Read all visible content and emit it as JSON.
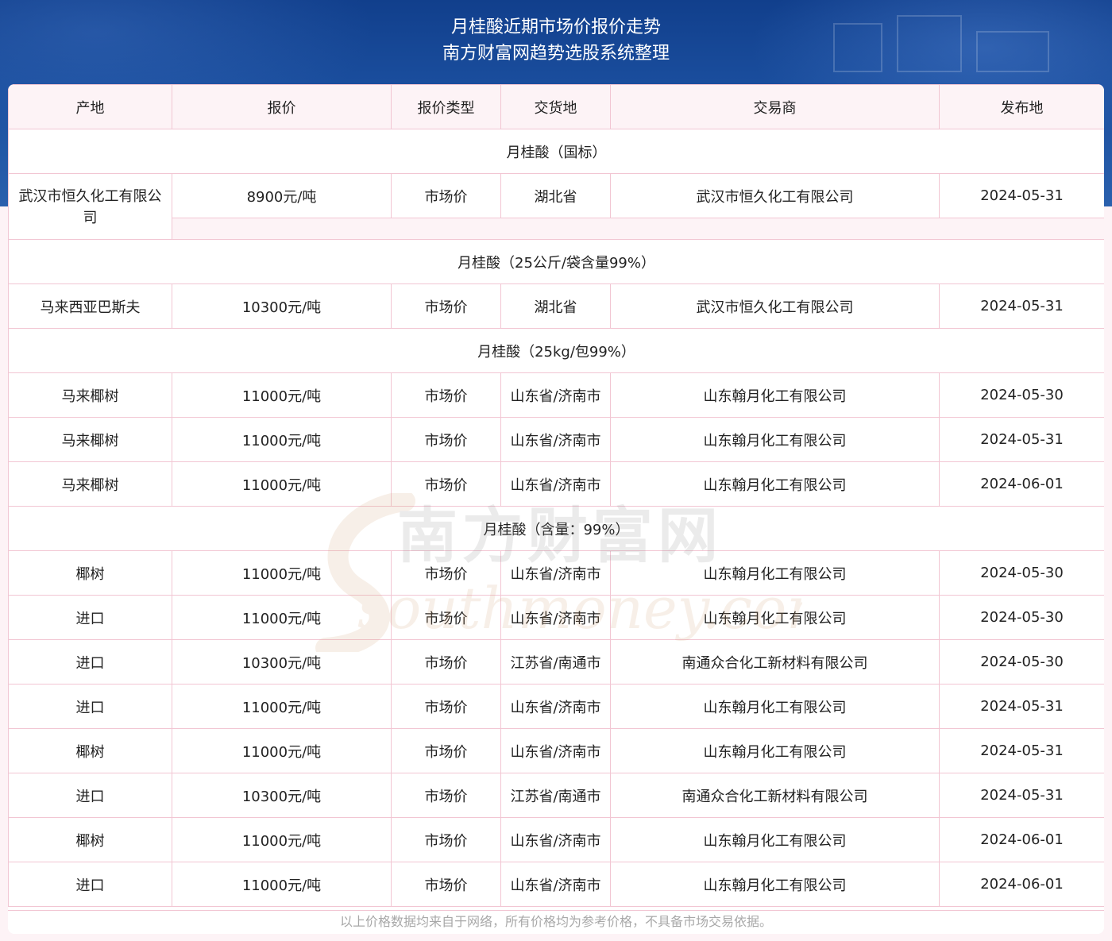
{
  "header": {
    "title_line1": "月桂酸近期市场价报价走势",
    "title_line2": "南方财富网趋势选股系统整理"
  },
  "table": {
    "columns": [
      "产地",
      "报价",
      "报价类型",
      "交货地",
      "交易商",
      "发布地"
    ],
    "groups": [
      {
        "name": "月桂酸（国标）",
        "rows": [
          {
            "origin": "武汉市恒久化工有限公司",
            "price": "8900元/吨",
            "type": "市场价",
            "delivery": "湖北省",
            "dealer": "武汉市恒久化工有限公司",
            "date": "2024-05-31"
          }
        ]
      },
      {
        "name": "月桂酸（25公斤/袋含量99%）",
        "rows": [
          {
            "origin": "马来西亚巴斯夫",
            "price": "10300元/吨",
            "type": "市场价",
            "delivery": "湖北省",
            "dealer": "武汉市恒久化工有限公司",
            "date": "2024-05-31"
          }
        ]
      },
      {
        "name": "月桂酸（25kg/包99%）",
        "rows": [
          {
            "origin": "马来椰树",
            "price": "11000元/吨",
            "type": "市场价",
            "delivery": "山东省/济南市",
            "dealer": "山东翰月化工有限公司",
            "date": "2024-05-30"
          },
          {
            "origin": "马来椰树",
            "price": "11000元/吨",
            "type": "市场价",
            "delivery": "山东省/济南市",
            "dealer": "山东翰月化工有限公司",
            "date": "2024-05-31"
          },
          {
            "origin": "马来椰树",
            "price": "11000元/吨",
            "type": "市场价",
            "delivery": "山东省/济南市",
            "dealer": "山东翰月化工有限公司",
            "date": "2024-06-01"
          }
        ]
      },
      {
        "name": "月桂酸（含量：99%）",
        "rows": [
          {
            "origin": "椰树",
            "price": "11000元/吨",
            "type": "市场价",
            "delivery": "山东省/济南市",
            "dealer": "山东翰月化工有限公司",
            "date": "2024-05-30"
          },
          {
            "origin": "进口",
            "price": "11000元/吨",
            "type": "市场价",
            "delivery": "山东省/济南市",
            "dealer": "山东翰月化工有限公司",
            "date": "2024-05-30"
          },
          {
            "origin": "进口",
            "price": "10300元/吨",
            "type": "市场价",
            "delivery": "江苏省/南通市",
            "dealer": "南通众合化工新材料有限公司",
            "date": "2024-05-30"
          },
          {
            "origin": "进口",
            "price": "11000元/吨",
            "type": "市场价",
            "delivery": "山东省/济南市",
            "dealer": "山东翰月化工有限公司",
            "date": "2024-05-31"
          },
          {
            "origin": "椰树",
            "price": "11000元/吨",
            "type": "市场价",
            "delivery": "山东省/济南市",
            "dealer": "山东翰月化工有限公司",
            "date": "2024-05-31"
          },
          {
            "origin": "进口",
            "price": "10300元/吨",
            "type": "市场价",
            "delivery": "江苏省/南通市",
            "dealer": "南通众合化工新材料有限公司",
            "date": "2024-05-31"
          },
          {
            "origin": "椰树",
            "price": "11000元/吨",
            "type": "市场价",
            "delivery": "山东省/济南市",
            "dealer": "山东翰月化工有限公司",
            "date": "2024-06-01"
          },
          {
            "origin": "进口",
            "price": "11000元/吨",
            "type": "市场价",
            "delivery": "山东省/济南市",
            "dealer": "山东翰月化工有限公司",
            "date": "2024-06-01"
          }
        ]
      }
    ]
  },
  "watermark": {
    "cn": "南方财富网",
    "en": "southmoney.com"
  },
  "footer": {
    "note": "以上价格数据均来自于网络，所有价格均为参考价格，不具备市场交易依据。"
  },
  "colors": {
    "banner": "#1b4f9f",
    "border": "#f2c6d3",
    "header_bg": "#fdf3f6",
    "watermark": "#d4a373"
  }
}
